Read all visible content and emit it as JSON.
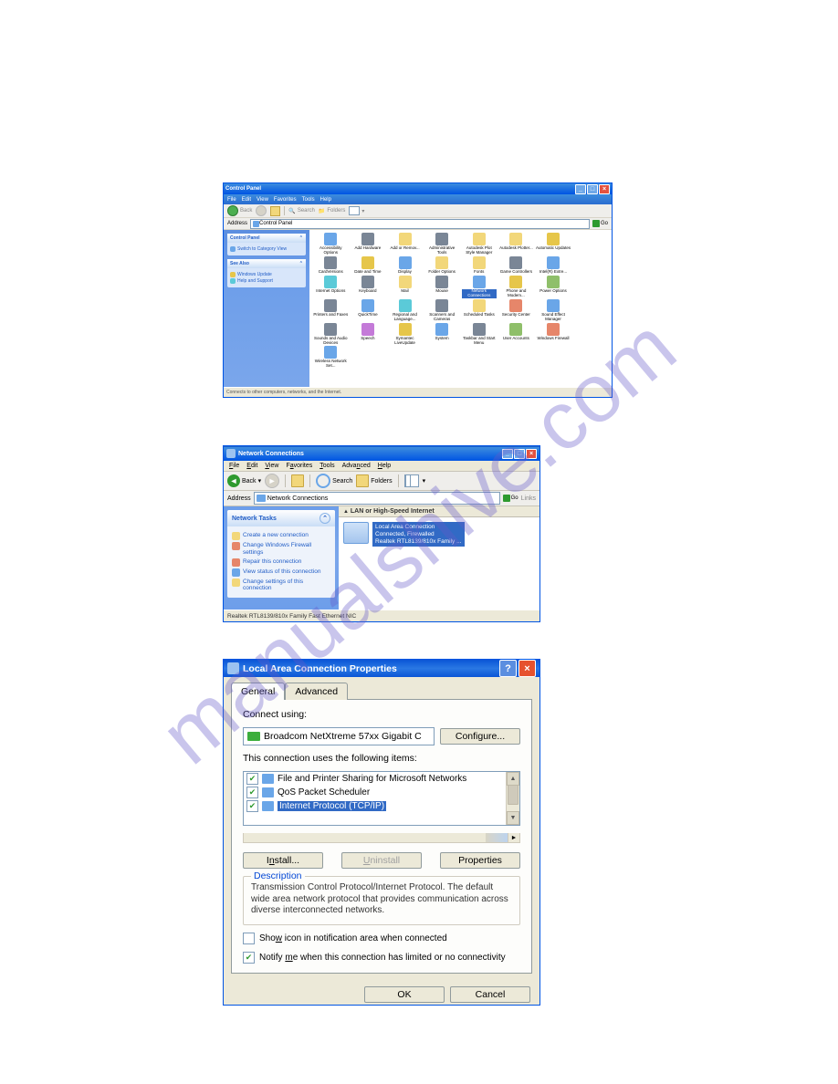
{
  "watermark": "manualshive.com",
  "win1": {
    "title": "Control Panel",
    "menu": [
      "File",
      "Edit",
      "View",
      "Favorites",
      "Tools",
      "Help"
    ],
    "toolbar": {
      "back": "Back",
      "search": "Search",
      "folders": "Folders"
    },
    "address_label": "Address",
    "address_value": "Control Panel",
    "go": "Go",
    "side": {
      "panel1": {
        "title": "Control Panel",
        "link": "Switch to Category View"
      },
      "panel2": {
        "title": "See Also",
        "links": [
          "Windows Update",
          "Help and Support"
        ]
      }
    },
    "icons": [
      {
        "label": "Accessibility Options",
        "c": "ic1"
      },
      {
        "label": "Add Hardware",
        "c": "ic6"
      },
      {
        "label": "Add or Remov...",
        "c": "ic2"
      },
      {
        "label": "Administrative Tools",
        "c": "ic6"
      },
      {
        "label": "Autodesk Plot Style Manager",
        "c": "ic2"
      },
      {
        "label": "Autodesk Plotter...",
        "c": "ic2"
      },
      {
        "label": "Automatic Updates",
        "c": "ic7"
      },
      {
        "label": "",
        "c": ""
      },
      {
        "label": "CardVersions",
        "c": "ic6"
      },
      {
        "label": "Date and Time",
        "c": "ic7"
      },
      {
        "label": "Display",
        "c": "ic1"
      },
      {
        "label": "Folder Options",
        "c": "ic2"
      },
      {
        "label": "Fonts",
        "c": "ic2"
      },
      {
        "label": "Game Controllers",
        "c": "ic6"
      },
      {
        "label": "Intel(R) Extre...",
        "c": "ic1"
      },
      {
        "label": "",
        "c": ""
      },
      {
        "label": "Internet Options",
        "c": "ic8"
      },
      {
        "label": "Keyboard",
        "c": "ic6"
      },
      {
        "label": "Mail",
        "c": "ic2"
      },
      {
        "label": "Mouse",
        "c": "ic6"
      },
      {
        "label": "Network Connections",
        "c": "ic1",
        "sel": true
      },
      {
        "label": "Phone and Modem...",
        "c": "ic7"
      },
      {
        "label": "Power Options",
        "c": "ic4"
      },
      {
        "label": "",
        "c": ""
      },
      {
        "label": "Printers and Faxes",
        "c": "ic6"
      },
      {
        "label": "QuickTime",
        "c": "ic1"
      },
      {
        "label": "Regional and Language...",
        "c": "ic8"
      },
      {
        "label": "Scanners and Cameras",
        "c": "ic6"
      },
      {
        "label": "Scheduled Tasks",
        "c": "ic2"
      },
      {
        "label": "Security Center",
        "c": "ic3"
      },
      {
        "label": "Sound Effect Manager",
        "c": "ic1"
      },
      {
        "label": "",
        "c": ""
      },
      {
        "label": "Sounds and Audio Devices",
        "c": "ic6"
      },
      {
        "label": "Speech",
        "c": "ic5"
      },
      {
        "label": "Symantec LiveUpdate",
        "c": "ic7"
      },
      {
        "label": "System",
        "c": "ic1"
      },
      {
        "label": "Taskbar and Start Menu",
        "c": "ic6"
      },
      {
        "label": "User Accounts",
        "c": "ic4"
      },
      {
        "label": "Windows Firewall",
        "c": "ic3"
      },
      {
        "label": "",
        "c": ""
      },
      {
        "label": "Wireless Network Set...",
        "c": "ic1"
      }
    ],
    "status": "Connects to other computers, networks, and the Internet."
  },
  "win2": {
    "title": "Network Connections",
    "menu": [
      "File",
      "Edit",
      "View",
      "Favorites",
      "Tools",
      "Advanced",
      "Help"
    ],
    "toolbar": {
      "back": "Back",
      "search": "Search",
      "folders": "Folders"
    },
    "address_label": "Address",
    "address_value": "Network Connections",
    "go": "Go",
    "links": "Links",
    "side": {
      "title": "Network Tasks",
      "tasks": [
        {
          "label": "Create a new connection",
          "c": "ic2"
        },
        {
          "label": "Change Windows Firewall settings",
          "c": "ic3"
        },
        {
          "label": "Repair this connection",
          "c": "ic3"
        },
        {
          "label": "View status of this connection",
          "c": "ic1"
        },
        {
          "label": "Change settings of this connection",
          "c": "ic2"
        }
      ]
    },
    "group": "LAN or High-Speed Internet",
    "conn": {
      "name": "Local Area Connection",
      "status": "Connected, Firewalled",
      "device": "Realtek RTL8139/810x Family ..."
    },
    "status": "Realtek RTL8139/810x Family Fast Ethernet NIC"
  },
  "win3": {
    "title": "Local Area Connection Properties",
    "tabs": [
      "General",
      "Advanced"
    ],
    "connect_using_label": "Connect using:",
    "adapter": "Broadcom NetXtreme 57xx Gigabit C",
    "configure": "Configure...",
    "items_label": "This connection uses the following items:",
    "items": [
      {
        "label": "File and Printer Sharing for Microsoft Networks",
        "checked": true
      },
      {
        "label": "QoS Packet Scheduler",
        "checked": true
      },
      {
        "label": "Internet Protocol (TCP/IP)",
        "checked": true,
        "sel": true
      }
    ],
    "install": "Install...",
    "uninstall": "Uninstall",
    "properties": "Properties",
    "desc_title": "Description",
    "desc": "Transmission Control Protocol/Internet Protocol. The default wide area network protocol that provides communication across diverse interconnected networks.",
    "show_icon": {
      "label": "Show icon in notification area when connected",
      "checked": false
    },
    "notify": {
      "label": "Notify me when this connection has limited or no connectivity",
      "checked": true
    },
    "ok": "OK",
    "cancel": "Cancel"
  }
}
